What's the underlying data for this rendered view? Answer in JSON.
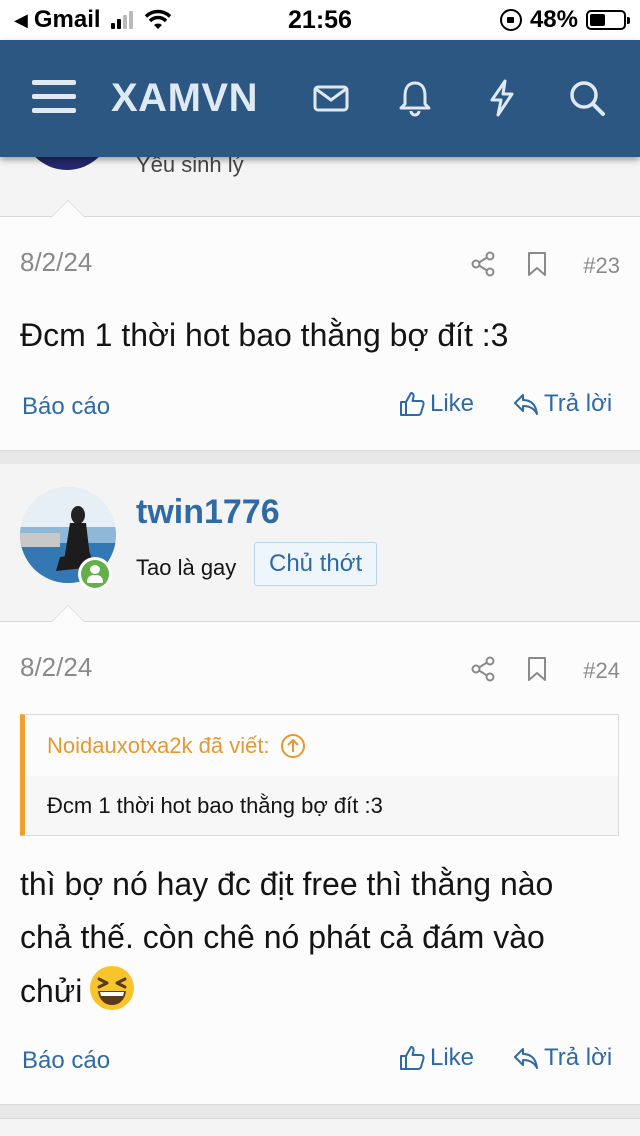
{
  "status_bar": {
    "back_app": "Gmail",
    "time": "21:56",
    "battery": "48%",
    "battery_level": 0.48
  },
  "nav": {
    "logo": "XAMVN",
    "icons": [
      "menu-icon",
      "mail-icon",
      "bell-icon",
      "lightning-icon",
      "search-icon"
    ]
  },
  "prev_user": {
    "title": "Yêu sinh lý"
  },
  "posts": [
    {
      "date": "8/2/24",
      "number": "#23",
      "message": "Đcm 1 thời hot bao thằng bợ đít :3",
      "report_label": "Báo cáo",
      "like_label": "Like",
      "reply_label": "Trả lời"
    },
    {
      "user": {
        "name": "twin1776",
        "title": "Tao là gay",
        "badge": "Chủ thớt"
      },
      "date": "8/2/24",
      "number": "#24",
      "quote": {
        "author": "Noidauxotxa2k đã viết:",
        "text": "Đcm 1 thời hot bao thằng bợ đít :3"
      },
      "message": "thì bợ nó hay đc địt free thì thằng nào chả thế. còn chê nó phát cả đám vào chửi",
      "emoji": "grinning-squinting-face",
      "report_label": "Báo cáo",
      "like_label": "Like",
      "reply_label": "Trả lời"
    }
  ],
  "colors": {
    "nav_bg": "#2c5782",
    "link": "#2f6aa5",
    "quote_accent": "#f0a030",
    "online": "#63b04a"
  }
}
